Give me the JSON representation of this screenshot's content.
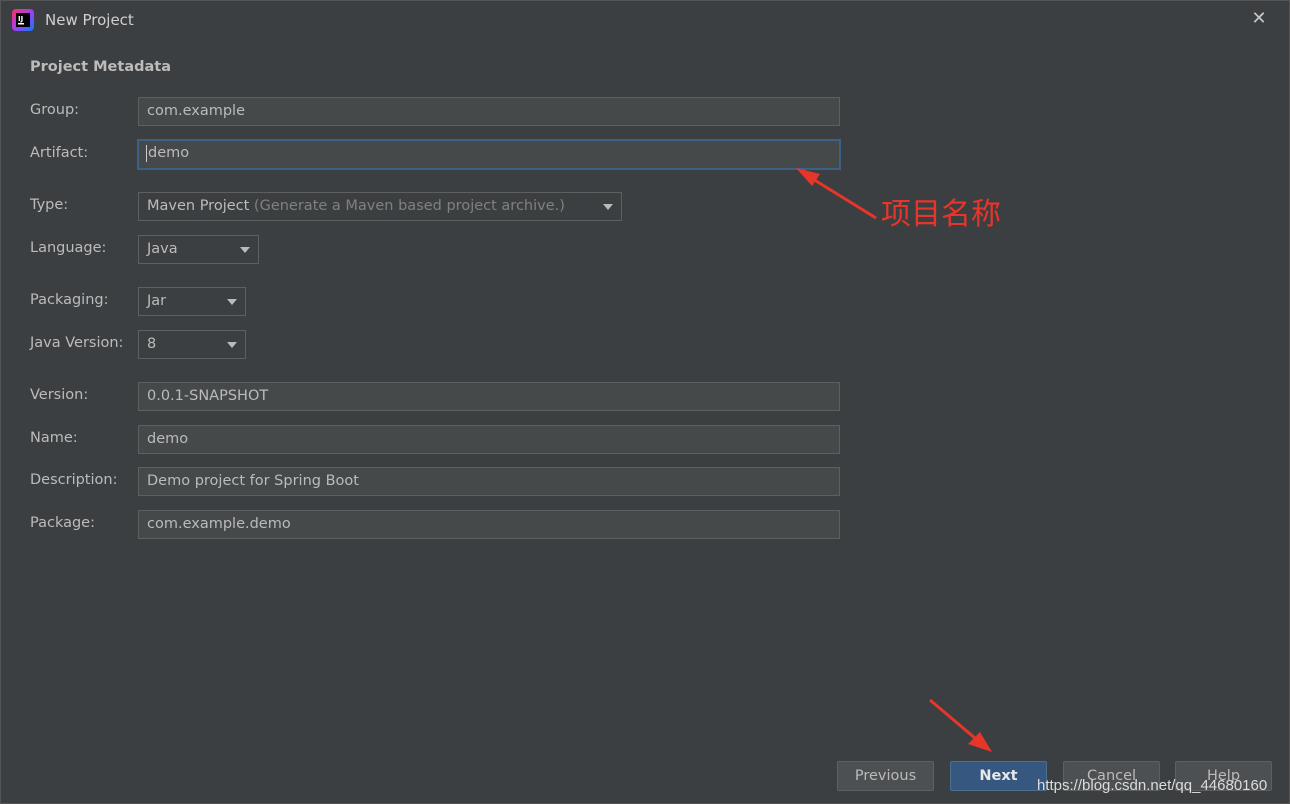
{
  "window": {
    "title": "New Project",
    "app_icon": "intellij-idea-icon",
    "close_glyph": "✕"
  },
  "section_title": "Project Metadata",
  "form": {
    "group": {
      "label": "Group:",
      "value": "com.example"
    },
    "artifact": {
      "label": "Artifact:",
      "value": "demo"
    },
    "type": {
      "label": "Type:",
      "value": "Maven Project",
      "hint": "(Generate a Maven based project archive.)"
    },
    "language": {
      "label": "Language:",
      "value": "Java"
    },
    "packaging": {
      "label": "Packaging:",
      "value": "Jar"
    },
    "java_version": {
      "label": "Java Version:",
      "value": "8"
    },
    "version": {
      "label": "Version:",
      "value": "0.0.1-SNAPSHOT"
    },
    "name": {
      "label": "Name:",
      "value": "demo"
    },
    "description": {
      "label": "Description:",
      "value": "Demo project for Spring Boot"
    },
    "package": {
      "label": "Package:",
      "value": "com.example.demo"
    }
  },
  "annotation": {
    "text": "项目名称",
    "color": "#e8352a"
  },
  "buttons": {
    "previous": "Previous",
    "next": "Next",
    "cancel": "Cancel",
    "help": "Help"
  },
  "watermark": "https://blog.csdn.net/qq_44680160",
  "colors": {
    "background": "#3c3f41",
    "field_bg": "#45494a",
    "focus_border": "#3d6185",
    "primary_button": "#365880"
  }
}
